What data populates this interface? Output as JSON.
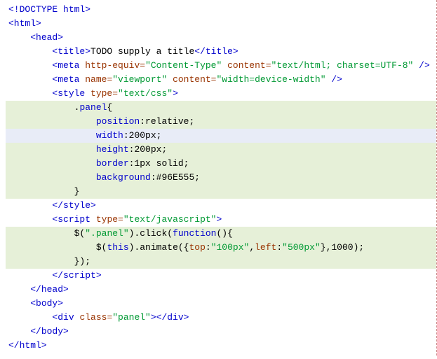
{
  "lines": [
    {
      "hl": "",
      "indent": 0,
      "spans": [
        {
          "cls": "tag",
          "t": "<!DOCTYPE html>"
        }
      ]
    },
    {
      "hl": "",
      "indent": 0,
      "spans": [
        {
          "cls": "tag",
          "t": "<html>"
        }
      ]
    },
    {
      "hl": "",
      "indent": 1,
      "spans": [
        {
          "cls": "tag",
          "t": "<head>"
        }
      ]
    },
    {
      "hl": "",
      "indent": 2,
      "spans": [
        {
          "cls": "tag",
          "t": "<title>"
        },
        {
          "cls": "text",
          "t": "TODO supply a title"
        },
        {
          "cls": "tag",
          "t": "</title>"
        }
      ]
    },
    {
      "hl": "",
      "indent": 2,
      "spans": [
        {
          "cls": "tag",
          "t": "<meta "
        },
        {
          "cls": "attr",
          "t": "http-equiv="
        },
        {
          "cls": "str",
          "t": "\"Content-Type\""
        },
        {
          "cls": "tag",
          "t": " "
        },
        {
          "cls": "attr",
          "t": "content="
        },
        {
          "cls": "str",
          "t": "\"text/html; charset=UTF-8\""
        },
        {
          "cls": "tag",
          "t": " />"
        }
      ]
    },
    {
      "hl": "",
      "indent": 2,
      "spans": [
        {
          "cls": "tag",
          "t": "<meta "
        },
        {
          "cls": "attr",
          "t": "name="
        },
        {
          "cls": "str",
          "t": "\"viewport\""
        },
        {
          "cls": "tag",
          "t": " "
        },
        {
          "cls": "attr",
          "t": "content="
        },
        {
          "cls": "str",
          "t": "\"width=device-width\""
        },
        {
          "cls": "tag",
          "t": " />"
        }
      ]
    },
    {
      "hl": "",
      "indent": 2,
      "spans": [
        {
          "cls": "tag",
          "t": "<style "
        },
        {
          "cls": "attr",
          "t": "type="
        },
        {
          "cls": "str",
          "t": "\"text/css\""
        },
        {
          "cls": "tag",
          "t": ">"
        }
      ]
    },
    {
      "hl": "hl-green",
      "indent": 3,
      "spans": [
        {
          "cls": "text",
          "t": "."
        },
        {
          "cls": "prop",
          "t": "panel"
        },
        {
          "cls": "text",
          "t": "{"
        }
      ]
    },
    {
      "hl": "hl-green",
      "indent": 4,
      "spans": [
        {
          "cls": "prop",
          "t": "position"
        },
        {
          "cls": "text",
          "t": ":relative;"
        }
      ]
    },
    {
      "hl": "hl-blue",
      "indent": 4,
      "spans": [
        {
          "cls": "prop",
          "t": "width"
        },
        {
          "cls": "text",
          "t": ":200px;"
        }
      ]
    },
    {
      "hl": "hl-green",
      "indent": 4,
      "spans": [
        {
          "cls": "prop",
          "t": "height"
        },
        {
          "cls": "text",
          "t": ":200px;"
        }
      ]
    },
    {
      "hl": "hl-green",
      "indent": 4,
      "spans": [
        {
          "cls": "prop",
          "t": "border"
        },
        {
          "cls": "text",
          "t": ":1px solid;"
        }
      ]
    },
    {
      "hl": "hl-green",
      "indent": 4,
      "spans": [
        {
          "cls": "prop",
          "t": "background"
        },
        {
          "cls": "text",
          "t": ":#96E555;"
        }
      ]
    },
    {
      "hl": "hl-green",
      "indent": 3,
      "spans": [
        {
          "cls": "text",
          "t": "}"
        }
      ]
    },
    {
      "hl": "",
      "indent": 2,
      "spans": [
        {
          "cls": "tag",
          "t": "</style>"
        }
      ]
    },
    {
      "hl": "",
      "indent": 2,
      "spans": [
        {
          "cls": "tag",
          "t": "<script "
        },
        {
          "cls": "attr",
          "t": "type="
        },
        {
          "cls": "str",
          "t": "\"text/javascript\""
        },
        {
          "cls": "tag",
          "t": ">"
        }
      ]
    },
    {
      "hl": "hl-green",
      "indent": 3,
      "spans": [
        {
          "cls": "text",
          "t": "$("
        },
        {
          "cls": "str",
          "t": "\".panel\""
        },
        {
          "cls": "text",
          "t": ").click("
        },
        {
          "cls": "kw",
          "t": "function"
        },
        {
          "cls": "text",
          "t": "(){"
        }
      ]
    },
    {
      "hl": "hl-green",
      "indent": 4,
      "spans": [
        {
          "cls": "text",
          "t": "$("
        },
        {
          "cls": "kw",
          "t": "this"
        },
        {
          "cls": "text",
          "t": ").animate({"
        },
        {
          "cls": "attr",
          "t": "top"
        },
        {
          "cls": "text",
          "t": ":"
        },
        {
          "cls": "str",
          "t": "\"100px\""
        },
        {
          "cls": "text",
          "t": ","
        },
        {
          "cls": "attr",
          "t": "left"
        },
        {
          "cls": "text",
          "t": ":"
        },
        {
          "cls": "str",
          "t": "\"500px\""
        },
        {
          "cls": "text",
          "t": "},1000);"
        }
      ]
    },
    {
      "hl": "hl-green",
      "indent": 3,
      "spans": [
        {
          "cls": "text",
          "t": "});"
        }
      ]
    },
    {
      "hl": "",
      "indent": 2,
      "spans": [
        {
          "cls": "tag",
          "t": "</script>"
        }
      ]
    },
    {
      "hl": "",
      "indent": 1,
      "spans": [
        {
          "cls": "tag",
          "t": "</head>"
        }
      ]
    },
    {
      "hl": "",
      "indent": 1,
      "spans": [
        {
          "cls": "tag",
          "t": "<body>"
        }
      ]
    },
    {
      "hl": "",
      "indent": 2,
      "spans": [
        {
          "cls": "tag",
          "t": "<div "
        },
        {
          "cls": "attr",
          "t": "class="
        },
        {
          "cls": "str",
          "t": "\"panel\""
        },
        {
          "cls": "tag",
          "t": "></div>"
        }
      ]
    },
    {
      "hl": "",
      "indent": 1,
      "spans": [
        {
          "cls": "tag",
          "t": "</body>"
        }
      ]
    },
    {
      "hl": "",
      "indent": 0,
      "spans": [
        {
          "cls": "tag",
          "t": "</html>"
        }
      ]
    }
  ]
}
